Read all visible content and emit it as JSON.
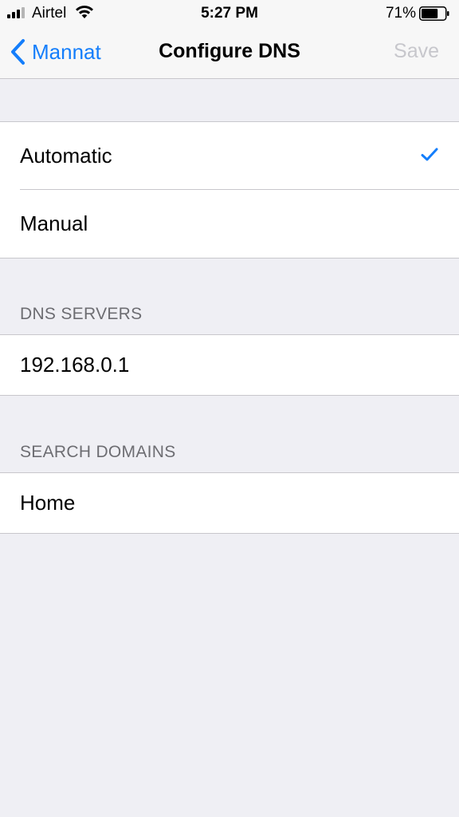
{
  "status_bar": {
    "carrier": "Airtel",
    "time": "5:27 PM",
    "battery_percent": "71%",
    "battery_level": 0.71
  },
  "nav": {
    "back_label": "Mannat",
    "title": "Configure DNS",
    "save_label": "Save"
  },
  "dns_mode": {
    "options": [
      {
        "label": "Automatic",
        "selected": true
      },
      {
        "label": "Manual",
        "selected": false
      }
    ]
  },
  "dns_servers": {
    "header": "DNS SERVERS",
    "items": [
      "192.168.0.1"
    ]
  },
  "search_domains": {
    "header": "SEARCH DOMAINS",
    "items": [
      "Home"
    ]
  },
  "colors": {
    "accent": "#147efb",
    "disabled": "#c7c7cc",
    "background": "#efeff4",
    "separator": "#c8c7cc"
  }
}
